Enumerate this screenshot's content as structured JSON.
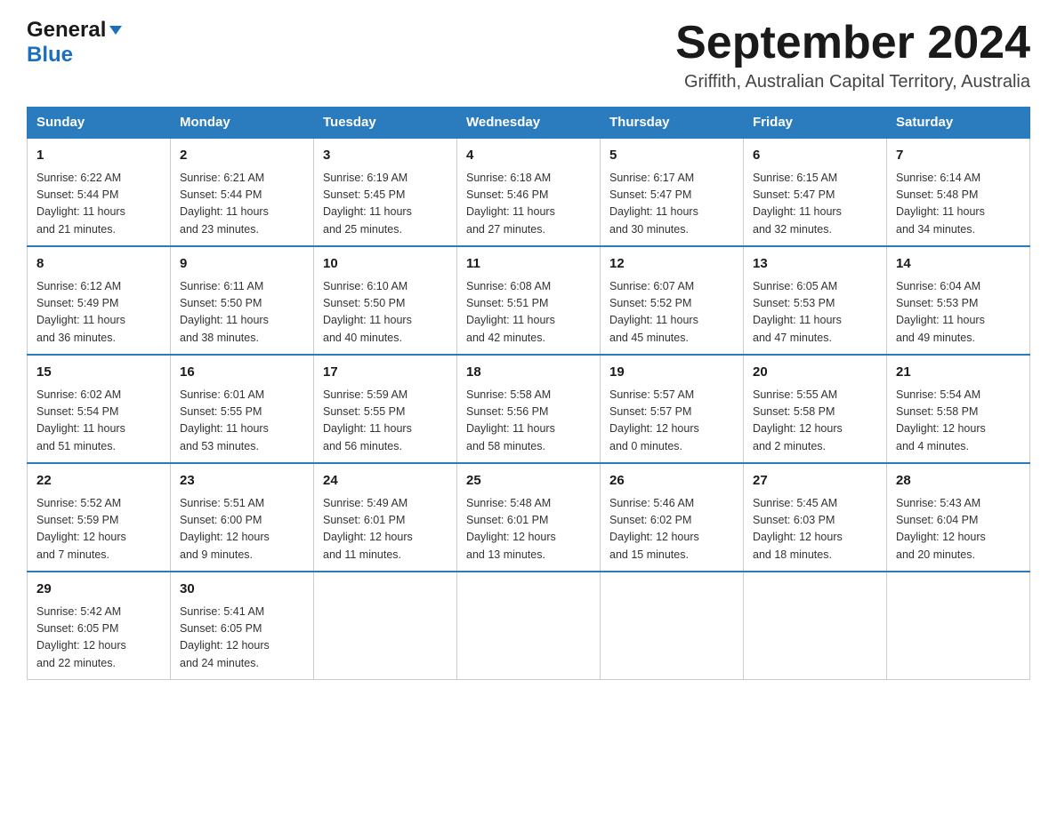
{
  "header": {
    "logo_general": "General",
    "logo_blue": "Blue",
    "month_title": "September 2024",
    "location": "Griffith, Australian Capital Territory, Australia"
  },
  "days_of_week": [
    "Sunday",
    "Monday",
    "Tuesday",
    "Wednesday",
    "Thursday",
    "Friday",
    "Saturday"
  ],
  "weeks": [
    [
      {
        "day": "1",
        "sunrise": "6:22 AM",
        "sunset": "5:44 PM",
        "daylight": "11 hours and 21 minutes."
      },
      {
        "day": "2",
        "sunrise": "6:21 AM",
        "sunset": "5:44 PM",
        "daylight": "11 hours and 23 minutes."
      },
      {
        "day": "3",
        "sunrise": "6:19 AM",
        "sunset": "5:45 PM",
        "daylight": "11 hours and 25 minutes."
      },
      {
        "day": "4",
        "sunrise": "6:18 AM",
        "sunset": "5:46 PM",
        "daylight": "11 hours and 27 minutes."
      },
      {
        "day": "5",
        "sunrise": "6:17 AM",
        "sunset": "5:47 PM",
        "daylight": "11 hours and 30 minutes."
      },
      {
        "day": "6",
        "sunrise": "6:15 AM",
        "sunset": "5:47 PM",
        "daylight": "11 hours and 32 minutes."
      },
      {
        "day": "7",
        "sunrise": "6:14 AM",
        "sunset": "5:48 PM",
        "daylight": "11 hours and 34 minutes."
      }
    ],
    [
      {
        "day": "8",
        "sunrise": "6:12 AM",
        "sunset": "5:49 PM",
        "daylight": "11 hours and 36 minutes."
      },
      {
        "day": "9",
        "sunrise": "6:11 AM",
        "sunset": "5:50 PM",
        "daylight": "11 hours and 38 minutes."
      },
      {
        "day": "10",
        "sunrise": "6:10 AM",
        "sunset": "5:50 PM",
        "daylight": "11 hours and 40 minutes."
      },
      {
        "day": "11",
        "sunrise": "6:08 AM",
        "sunset": "5:51 PM",
        "daylight": "11 hours and 42 minutes."
      },
      {
        "day": "12",
        "sunrise": "6:07 AM",
        "sunset": "5:52 PM",
        "daylight": "11 hours and 45 minutes."
      },
      {
        "day": "13",
        "sunrise": "6:05 AM",
        "sunset": "5:53 PM",
        "daylight": "11 hours and 47 minutes."
      },
      {
        "day": "14",
        "sunrise": "6:04 AM",
        "sunset": "5:53 PM",
        "daylight": "11 hours and 49 minutes."
      }
    ],
    [
      {
        "day": "15",
        "sunrise": "6:02 AM",
        "sunset": "5:54 PM",
        "daylight": "11 hours and 51 minutes."
      },
      {
        "day": "16",
        "sunrise": "6:01 AM",
        "sunset": "5:55 PM",
        "daylight": "11 hours and 53 minutes."
      },
      {
        "day": "17",
        "sunrise": "5:59 AM",
        "sunset": "5:55 PM",
        "daylight": "11 hours and 56 minutes."
      },
      {
        "day": "18",
        "sunrise": "5:58 AM",
        "sunset": "5:56 PM",
        "daylight": "11 hours and 58 minutes."
      },
      {
        "day": "19",
        "sunrise": "5:57 AM",
        "sunset": "5:57 PM",
        "daylight": "12 hours and 0 minutes."
      },
      {
        "day": "20",
        "sunrise": "5:55 AM",
        "sunset": "5:58 PM",
        "daylight": "12 hours and 2 minutes."
      },
      {
        "day": "21",
        "sunrise": "5:54 AM",
        "sunset": "5:58 PM",
        "daylight": "12 hours and 4 minutes."
      }
    ],
    [
      {
        "day": "22",
        "sunrise": "5:52 AM",
        "sunset": "5:59 PM",
        "daylight": "12 hours and 7 minutes."
      },
      {
        "day": "23",
        "sunrise": "5:51 AM",
        "sunset": "6:00 PM",
        "daylight": "12 hours and 9 minutes."
      },
      {
        "day": "24",
        "sunrise": "5:49 AM",
        "sunset": "6:01 PM",
        "daylight": "12 hours and 11 minutes."
      },
      {
        "day": "25",
        "sunrise": "5:48 AM",
        "sunset": "6:01 PM",
        "daylight": "12 hours and 13 minutes."
      },
      {
        "day": "26",
        "sunrise": "5:46 AM",
        "sunset": "6:02 PM",
        "daylight": "12 hours and 15 minutes."
      },
      {
        "day": "27",
        "sunrise": "5:45 AM",
        "sunset": "6:03 PM",
        "daylight": "12 hours and 18 minutes."
      },
      {
        "day": "28",
        "sunrise": "5:43 AM",
        "sunset": "6:04 PM",
        "daylight": "12 hours and 20 minutes."
      }
    ],
    [
      {
        "day": "29",
        "sunrise": "5:42 AM",
        "sunset": "6:05 PM",
        "daylight": "12 hours and 22 minutes."
      },
      {
        "day": "30",
        "sunrise": "5:41 AM",
        "sunset": "6:05 PM",
        "daylight": "12 hours and 24 minutes."
      },
      null,
      null,
      null,
      null,
      null
    ]
  ],
  "labels": {
    "sunrise_prefix": "Sunrise: ",
    "sunset_prefix": "Sunset: ",
    "daylight_prefix": "Daylight: "
  }
}
